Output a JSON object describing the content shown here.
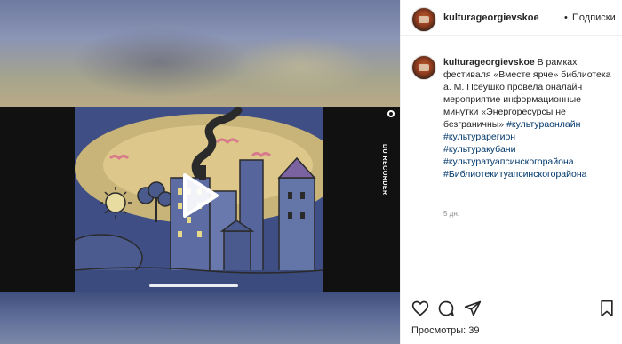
{
  "header": {
    "username": "kulturageorgievskoe",
    "separator": "•",
    "follow_label": "Подписки"
  },
  "caption": {
    "username": "kulturageorgievskoe",
    "text": "В рамках фестиваля «Вместе ярче» библиотека а. М. Псеушко провела оналайн мероприятие информационные минутки «Энергоресурсы не безграничны»",
    "first_tag": "#культураонлайн",
    "tags": [
      "#культурарегион",
      "#культуракубани",
      "#культуратуапсинскогорайона",
      "#Библиотекитуапсинскогорайона"
    ],
    "time": "5 дн."
  },
  "video": {
    "recorder_label": "DU RECORDER"
  },
  "stats": {
    "views_label": "Просмотры:",
    "views_count": "39"
  },
  "icons": {
    "like": "heart-icon",
    "comment": "comment-icon",
    "share": "share-icon",
    "save": "bookmark-icon",
    "play": "play-icon"
  }
}
